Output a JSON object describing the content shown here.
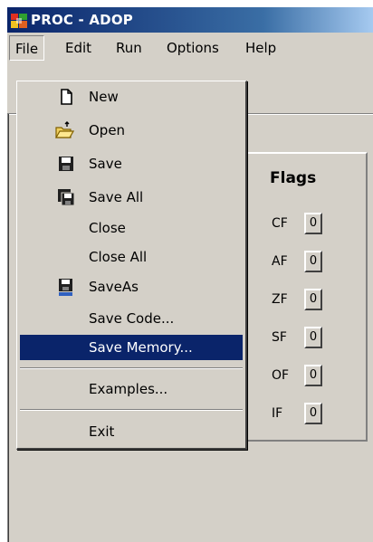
{
  "window": {
    "title": "PROC - ADOP",
    "app_icon": "proc-app-icon"
  },
  "menubar": {
    "items": [
      {
        "label": "File",
        "open": true
      },
      {
        "label": "Edit"
      },
      {
        "label": "Run"
      },
      {
        "label": "Options"
      },
      {
        "label": "Help"
      }
    ]
  },
  "file_menu": {
    "items": [
      {
        "label": "New",
        "icon": "new-file-icon"
      },
      {
        "label": "Open",
        "icon": "open-folder-icon"
      },
      {
        "label": "Save",
        "icon": "save-disk-icon"
      },
      {
        "label": "Save All",
        "icon": "save-all-icon"
      },
      {
        "label": "Close"
      },
      {
        "label": "Close All"
      },
      {
        "label": "SaveAs",
        "icon": "save-as-icon"
      },
      {
        "label": "Save Code..."
      },
      {
        "label": "Save Memory...",
        "selected": true
      },
      {
        "label": "Examples..."
      },
      {
        "label": "Exit"
      }
    ]
  },
  "flags": {
    "title": "Flags",
    "items": [
      {
        "name": "CF",
        "value": "0"
      },
      {
        "name": "AF",
        "value": "0"
      },
      {
        "name": "ZF",
        "value": "0"
      },
      {
        "name": "SF",
        "value": "0"
      },
      {
        "name": "OF",
        "value": "0"
      },
      {
        "name": "IF",
        "value": "0"
      }
    ]
  },
  "colors": {
    "titlebar": "#0a246a",
    "highlight": "#0a246a",
    "face": "#d4d0c8"
  }
}
